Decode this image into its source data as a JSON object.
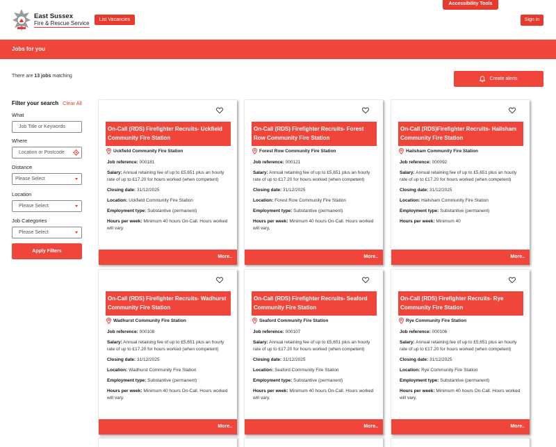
{
  "header": {
    "accessibility_tools": "Accessibility Tools",
    "logo_line1": "East Sussex",
    "logo_line2": "Fire & Rescue Service",
    "list_vacancies": "List Vacancies",
    "sign_in": "Sign in"
  },
  "banner": {
    "title": "Jobs for you"
  },
  "results": {
    "prefix": "There are ",
    "count": "13 jobs",
    "suffix": " matching",
    "create_alerts": "Create alerts"
  },
  "filters": {
    "title": "Filter your search",
    "clear_all": "Clear All",
    "what_label": "What",
    "what_placeholder": "Job Title or Keywords",
    "where_label": "Where",
    "where_placeholder": "Location or Postcode",
    "distance_label": "Distance",
    "distance_value": "Please Select",
    "location_label": "Location",
    "location_value": "Please Select",
    "categories_label": "Job Categories",
    "categories_value": "Please Select",
    "apply": "Apply Filters"
  },
  "labels": {
    "job_ref": "Job reference:",
    "salary": "Salary:",
    "closing": "Closing date:",
    "location": "Location:",
    "employment": "Employment type:",
    "hours": "Hours per week:",
    "more": "More.."
  },
  "jobs": [
    {
      "title": "On-Call (RDS) Firefighter Recruits- Uckfield Community Fire Station",
      "station": "Uckfield Community Fire Station",
      "ref": "000181",
      "salary": "Annual retaining fee of up to £5,651 plus an hourly rate of up to £17.20 for hours worked (when competent)",
      "closing": "31/12/2025",
      "location": "Uckfield Community Fire Station",
      "employment": "Substantive (permanent)",
      "hours": "Minimum 40 hours On-Call. Hours worked will vary."
    },
    {
      "title": "On-Call (RDS) Firefighter Recruits- Forest Row Community Fire Station",
      "station": "Forest Row Community Fire Station",
      "ref": "000121",
      "salary": "Annual retaining fee of up to £5,651 plus an hourly rate of up to £17.20 for hours worked (when competent)",
      "closing": "31/12/2025",
      "location": "Forest Row Community Fire Station",
      "employment": "Substantive (permanent)",
      "hours": "Minimum 40 hours On-Call. Hours worked will vary."
    },
    {
      "title": "On-Call (RDS)Firefighter Recruits- Hailsham Community Fire Station",
      "station": "Hailsham Community Fire Station",
      "ref": "000092",
      "salary": "Annual retaining fee of up to £5,651 plus an hourly rate of up to £17.20 for hours worked (when competent)",
      "closing": "31/12/2025",
      "location": "Hailsham Community Fire Station",
      "employment": "Substantive (permanent)",
      "hours": "Minimum 40"
    },
    {
      "title": "On-Call (RDS) Firefighter Recruits- Wadhurst Community Fire Station",
      "station": "Wadhurst Community Fire Station",
      "ref": "000108",
      "salary": "Annual retaining fee of up to £5,651 plus an hourly rate of up to £17.20 for hours worked (when competent)",
      "closing": "31/12/2025",
      "location": "Wadhurst Community Fire Station",
      "employment": "Substantive (permanent)",
      "hours": "Minimum 40 hours On-Call. Hours worked will vary."
    },
    {
      "title": "On-Call (RDS) Firefighter Recruits- Seaford Community Fire Station",
      "station": "Seaford Community Fire Station",
      "ref": "000107",
      "salary": "Annual retaining fee of up to £5,651 plus an hourly rate of up to £17.20 for hours worked (when competent)",
      "closing": "31/12/2025",
      "location": "Seaford Community Fire Station",
      "employment": "Substantive (permanent)",
      "hours": "Minimum 40 hours On-Call. Hours worked will vary."
    },
    {
      "title": "On-Call (RDS) Firefighter Recruits- Rye Community Fire Station",
      "station": "Rye Community Fire Station",
      "ref": "000106",
      "salary": "Annual retaining fee of up to £5,651 plus an hourly rate of up to £17.20 for hours worked (when competent)",
      "closing": "31/12/2025",
      "location": "Rye Community Fire Station",
      "employment": "Substantive (permanent)",
      "hours": "Minimum 40 hours On-Call. Hours worked will vary."
    }
  ],
  "icons": {
    "accessibility": "accessibility-icon",
    "logo": "fire-service-crest-icon",
    "bell": "bell-icon",
    "location_target": "location-target-icon",
    "caret": "chevron-down-icon",
    "heart": "heart-icon",
    "pin": "map-pin-icon"
  },
  "colors": {
    "accent": "#f0453a",
    "brand_red": "#e8392d"
  }
}
